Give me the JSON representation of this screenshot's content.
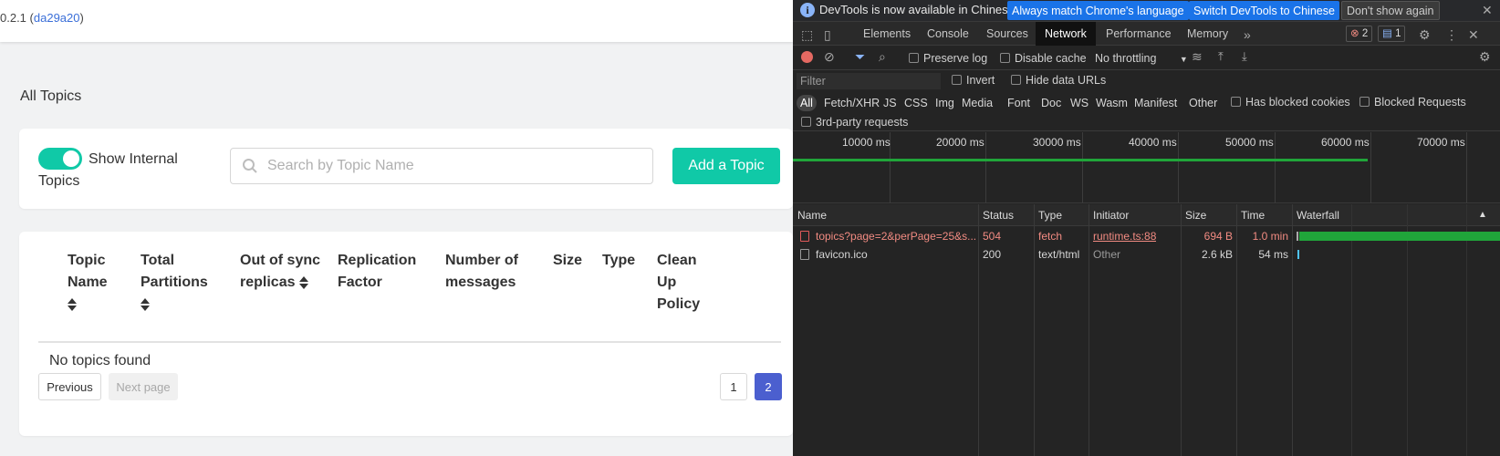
{
  "app": {
    "version": "0.2.1",
    "version_hash": "da29a20",
    "page_title": "All Topics",
    "toggle_label": "Show Internal Topics",
    "search_placeholder": "Search by Topic Name",
    "add_button": "Add a Topic",
    "columns": [
      "Topic Name",
      "Total Partitions",
      "Out of sync replicas",
      "Replication Factor",
      "Number of messages",
      "Size",
      "Type",
      "Clean Up Policy"
    ],
    "empty_text": "No topics found",
    "prev_label": "Previous",
    "next_label": "Next page",
    "pages": [
      "1",
      "2"
    ],
    "current_page": "2"
  },
  "devtools": {
    "infobar": {
      "text": "DevTools is now available in Chinese!",
      "match_button": "Always match Chrome's language",
      "switch_button": "Switch DevTools to Chinese",
      "dismiss_button": "Don't show again"
    },
    "tabs": [
      "Elements",
      "Console",
      "Sources",
      "Network",
      "Performance",
      "Memory"
    ],
    "active_tab": "Network",
    "errors_count": "2",
    "messages_count": "1",
    "toolbar": {
      "preserve_log": "Preserve log",
      "disable_cache": "Disable cache",
      "throttling": "No throttling"
    },
    "filter": {
      "placeholder": "Filter",
      "invert": "Invert",
      "hide_data_urls": "Hide data URLs"
    },
    "types": [
      "All",
      "Fetch/XHR",
      "JS",
      "CSS",
      "Img",
      "Media",
      "Font",
      "Doc",
      "WS",
      "Wasm",
      "Manifest",
      "Other"
    ],
    "has_blocked_cookies": "Has blocked cookies",
    "blocked_requests": "Blocked Requests",
    "third_party": "3rd-party requests",
    "timeline_labels": [
      "10000 ms",
      "20000 ms",
      "30000 ms",
      "40000 ms",
      "50000 ms",
      "60000 ms",
      "70000 ms"
    ],
    "columns": [
      "Name",
      "Status",
      "Type",
      "Initiator",
      "Size",
      "Time",
      "Waterfall"
    ],
    "requests": [
      {
        "name": "topics?page=2&perPage=25&s...",
        "status": "504",
        "type": "fetch",
        "initiator": "runtime.ts:88",
        "size": "694 B",
        "time": "1.0 min",
        "error": true
      },
      {
        "name": "favicon.ico",
        "status": "200",
        "type": "text/html",
        "initiator": "Other",
        "size": "2.6 kB",
        "time": "54 ms",
        "error": false
      }
    ],
    "colors": {
      "accent": "#10c9a7",
      "error": "#f28b82",
      "bar": "#20a53a",
      "link": "#1a73e8"
    }
  }
}
